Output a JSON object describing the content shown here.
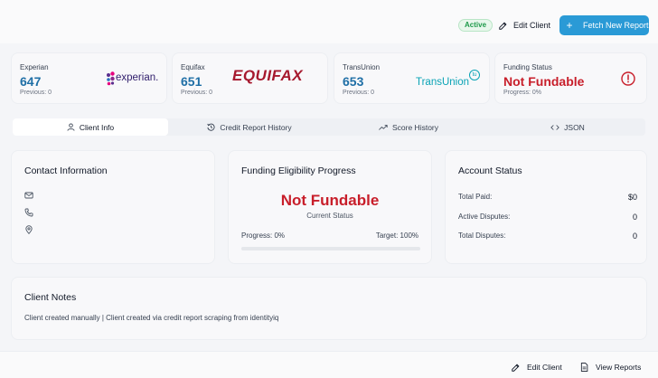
{
  "header": {
    "status_badge": "Active",
    "edit_label": "Edit Client",
    "fetch_label": "Fetch New Report"
  },
  "bureaus": [
    {
      "name": "Experian",
      "score": "647",
      "previous": "Previous: 0",
      "logo_text": "experian."
    },
    {
      "name": "Equifax",
      "score": "651",
      "previous": "Previous: 0",
      "logo_text": "EQUIFAX"
    },
    {
      "name": "TransUnion",
      "score": "653",
      "previous": "Previous: 0",
      "logo_text": "TransUnion",
      "logo_mark": "tu"
    }
  ],
  "funding_card": {
    "title": "Funding Status",
    "status": "Not Fundable",
    "progress": "Progress: 0%"
  },
  "tabs": [
    {
      "label": "Client Info",
      "icon": "user-icon",
      "active": true
    },
    {
      "label": "Credit Report History",
      "icon": "history-icon",
      "active": false
    },
    {
      "label": "Score History",
      "icon": "trend-icon",
      "active": false
    },
    {
      "label": "JSON",
      "icon": "code-icon",
      "active": false
    }
  ],
  "contact": {
    "title": "Contact Information",
    "icons": [
      "mail-icon",
      "phone-icon",
      "location-pin-icon"
    ]
  },
  "funding_progress": {
    "title": "Funding Eligibility Progress",
    "status": "Not Fundable",
    "status_caption": "Current Status",
    "progress_label": "Progress: 0%",
    "target_label": "Target: 100%",
    "progress_fraction": 0
  },
  "account": {
    "title": "Account Status",
    "rows": [
      {
        "label": "Total Paid:",
        "value": "$0"
      },
      {
        "label": "Active Disputes:",
        "value": "0"
      },
      {
        "label": "Total Disputes:",
        "value": "0"
      }
    ]
  },
  "notes": {
    "title": "Client Notes",
    "text": "Client created manually | Client created via credit report scraping from identityiq"
  },
  "footer": {
    "edit_label": "Edit Client",
    "view_label": "View Reports"
  },
  "colors": {
    "accent": "#2a9ad6",
    "score": "#1f6fa6",
    "danger": "#c81e2a",
    "experian_purple": "#5b2d8e",
    "experian_magenta": "#e6007e",
    "equifax_red": "#a6192e",
    "transunion_teal": "#0aa3b5"
  }
}
